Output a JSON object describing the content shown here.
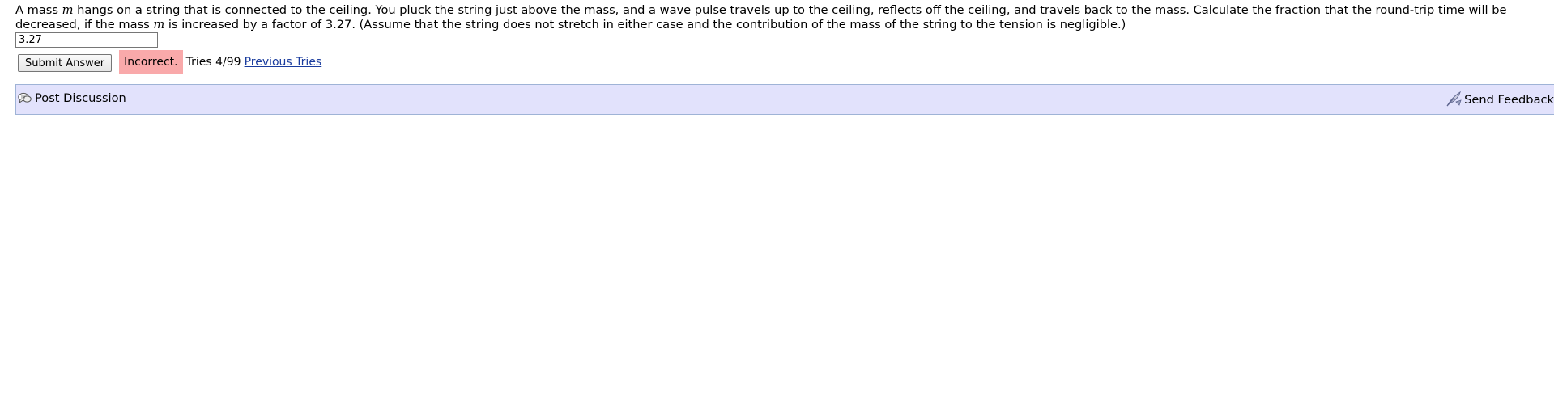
{
  "problem": {
    "text_part1": "A mass ",
    "var_m1": "m",
    "text_part2": " hangs on a string that is connected to the ceiling. You pluck the string just above the mass, and a wave pulse travels up to the ceiling, reflects off the ceiling, and travels back to the mass. Calculate the fraction that the round-trip time will be decreased, if the mass ",
    "var_m2": "m",
    "text_part3": " is increased by a factor of 3.27. (Assume that the string does not stretch in either case and the contribution of the mass of the string to the tension is negligible.)"
  },
  "answer": {
    "value": "3.27"
  },
  "controls": {
    "submit_label": "Submit Answer",
    "status_label": "Incorrect.",
    "tries_label": "Tries 4/99",
    "previous_tries_label": "Previous Tries"
  },
  "discussion_bar": {
    "post_discussion_label": "Post Discussion",
    "send_feedback_label": "Send Feedback"
  },
  "icons": {
    "post_discussion": "speech-bubbles-icon",
    "send_feedback": "quill-pen-icon"
  },
  "colors": {
    "incorrect_badge": "#f9a9aa",
    "discussion_bar_bg": "#e2e2fc",
    "discussion_bar_border": "#9fb3d6",
    "link": "#1a3c9e"
  }
}
